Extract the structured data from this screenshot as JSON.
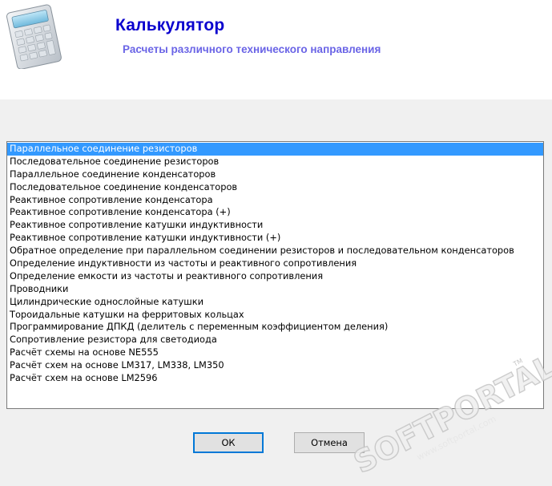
{
  "header": {
    "title": "Калькулятор",
    "subtitle": "Расчеты различного технического направления",
    "icon": "calculator-icon"
  },
  "list": {
    "selected_index": 0,
    "items": [
      "Параллельное соединение резисторов",
      "Последовательное соединение резисторов",
      "Параллельное соединение конденсаторов",
      "Последовательное соединение конденсаторов",
      "Реактивное сопротивление конденсатора",
      "Реактивное сопротивление конденсатора (+)",
      "Реактивное сопротивление катушки индуктивности",
      "Реактивное сопротивление катушки индуктивности (+)",
      "Обратное определение при параллельном соединении резисторов и последовательном конденсаторов",
      "Определение индуктивности из частоты и реактивного сопротивления",
      "Определение емкости из частоты и реактивного сопротивления",
      "Проводники",
      "Цилиндрические однослойные катушки",
      "Тороидальные катушки на ферритовых кольцах",
      "Программирование ДПКД (делитель с переменным коэффициентом деления)",
      "Сопротивление резистора для светодиода",
      "Расчёт схемы на основе NE555",
      "Расчёт схем на основе LM317, LM338, LM350",
      "Расчёт схем на основе LM2596"
    ]
  },
  "buttons": {
    "ok_label": "ОК",
    "cancel_label": "Отмена"
  },
  "watermark": {
    "brand": "SOFTPORTAL",
    "trademark": "TM",
    "url": "www.softportal.com"
  },
  "colors": {
    "title": "#0a00ce",
    "subtitle": "#6a64e6",
    "selection": "#3399ff",
    "window_bg": "#f0f0f0"
  }
}
